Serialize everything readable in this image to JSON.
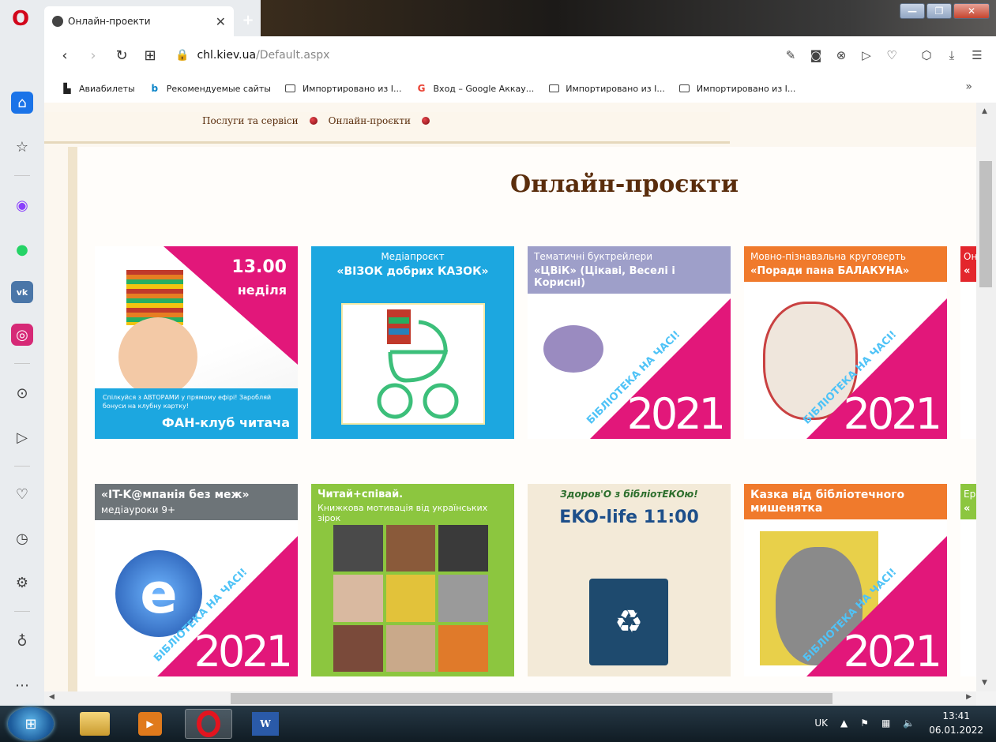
{
  "browser": {
    "tab_title": "Онлайн-проекти",
    "tab_close": "✕",
    "new_tab": "+",
    "url_domain": "chl.kiev.ua",
    "url_path": "/Default.aspx"
  },
  "bookmarks": [
    {
      "label": "Авиабилеты",
      "icon": "document-icon"
    },
    {
      "label": "Рекомендуемые сайты",
      "icon": "bing-icon"
    },
    {
      "label": "Импортировано из I...",
      "icon": "folder-icon"
    },
    {
      "label": "Вход – Google Аккау...",
      "icon": "google-icon"
    },
    {
      "label": "Импортировано из I...",
      "icon": "folder-icon"
    },
    {
      "label": "Импортировано из I...",
      "icon": "folder-icon"
    }
  ],
  "bookmarks_more": "»",
  "page": {
    "breadcrumb": [
      "Послуги та сервіси",
      "Онлайн-проєкти"
    ],
    "title": "Онлайн-проєкти"
  },
  "cards": [
    {
      "l1": "13.00",
      "l2": "неділя",
      "bottom": "ФАН-клуб читача",
      "sub": "Спілкуйся з АВТОРАМИ у прямому ефірі! Заробляй бонуси на клубну картку!",
      "color": "#e2177a"
    },
    {
      "l1": "Медіапроєкт",
      "l2": "«ВІЗОК добрих КАЗОК»",
      "color": "#1ca7e0"
    },
    {
      "l1": "Тематичні буктрейлери",
      "l2": "«ЦВіК» (Цікаві, Веселі і Корисні)",
      "color": "#9e9fc9"
    },
    {
      "l1": "Мовно-пізнавальна круговерть",
      "l2": "«Поради пана БАЛАКУНА»",
      "color": "#f07a2c"
    },
    {
      "l1": "«IT-K@мпанія без меж»",
      "l2": "медіауроки 9+",
      "color": "#6d7478"
    },
    {
      "l1": "Читай+співай.",
      "l2": "Книжкова мотивація від українських зірок",
      "color": "#8cc63f"
    },
    {
      "l1": "Здоров'О з бібліотЕКОю!",
      "l2": "EKO-life  11:00",
      "color": "#f3ead8"
    },
    {
      "l1": "Казка від бібліотечного",
      "l2": "мишенятка",
      "color": "#f07a2c"
    }
  ],
  "card_badge": "БІБЛІОТЕКА НА ЧАСІ!",
  "card_year": "2021",
  "edge_cards": [
    {
      "l1": "Он",
      "l2": "«"
    },
    {
      "l1": "Ер",
      "l2": "«"
    }
  ],
  "taskbar": {
    "lang": "UK",
    "time": "13:41",
    "date": "06.01.2022"
  }
}
